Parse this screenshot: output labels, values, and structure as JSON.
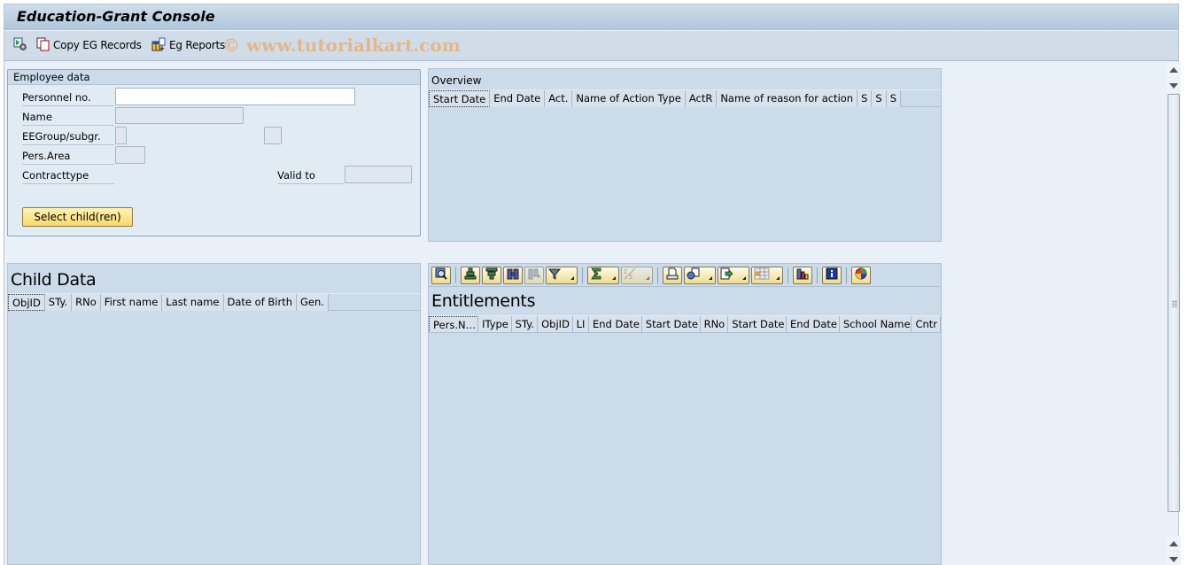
{
  "window": {
    "title": "Education-Grant Console"
  },
  "toolbar": {
    "items": [
      {
        "icon": "execute-settings-icon",
        "label": ""
      },
      {
        "icon": "copy-icon",
        "label": "Copy EG Records"
      },
      {
        "icon": "report-icon",
        "label": "Eg Reports"
      }
    ],
    "watermark": "© www.tutorialkart.com"
  },
  "employee_data": {
    "title": "Employee data",
    "fields": {
      "personnel_no": {
        "label": "Personnel no.",
        "value": ""
      },
      "name": {
        "label": "Name",
        "value": ""
      },
      "eegroup": {
        "label": "EEGroup/subgr.",
        "value1": "",
        "value2": ""
      },
      "pers_area": {
        "label": "Pers.Area",
        "value": ""
      },
      "contract_type": {
        "label": "Contracttype"
      },
      "valid_to": {
        "label": "Valid to",
        "value": ""
      }
    },
    "select_children_button": "Select child(ren)"
  },
  "overview": {
    "title": "Overview",
    "columns": [
      "Start Date",
      "End Date",
      "Act.",
      "Name of Action Type",
      "ActR",
      "Name of reason for action",
      "S",
      "S",
      "S"
    ],
    "rows": []
  },
  "child_data": {
    "title": "Child Data",
    "columns": [
      "ObjID",
      "STy.",
      "RNo",
      "First name",
      "Last name",
      "Date of Birth",
      "Gen."
    ],
    "rows": []
  },
  "entitlements": {
    "title": "Entitlements",
    "toolbar_icons": [
      "details-icon",
      "sort-ascending-icon",
      "sort-descending-icon",
      "find-icon",
      "find-next-icon",
      "filter-icon",
      "sum-icon",
      "subtotal-icon",
      "print-preview-icon",
      "views-icon",
      "export-icon",
      "layout-icon",
      "graphic-icon",
      "info-icon",
      "abc-analysis-icon"
    ],
    "columns": [
      "Pers.N…",
      "IType",
      "STy.",
      "ObjID",
      "LI",
      "End Date",
      "Start Date",
      "RNo",
      "Start Date",
      "End Date",
      "School Name",
      "Cntr"
    ],
    "rows": []
  }
}
